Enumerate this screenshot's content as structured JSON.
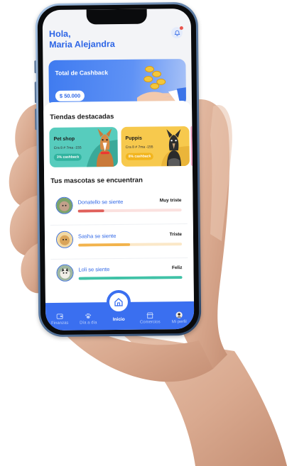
{
  "greeting": {
    "line1": "Hola,",
    "line2": "Maria Alejandra"
  },
  "icons": {
    "bell": "bell-icon",
    "hand_coins": "hand-coins-icon"
  },
  "cashback": {
    "title": "Total de Cashback",
    "amount": "$ 50.000"
  },
  "featured": {
    "title": "Tiendas destacadas",
    "stores": [
      {
        "name": "Pet shop",
        "address": "Cra 8 # 7ma -155",
        "badge": "3% cashback",
        "bg": "#57ccbd",
        "badge_color": "#31b39f"
      },
      {
        "name": "Puppis",
        "address": "Cra 8 # 7ma -155",
        "badge": "8% cashback",
        "bg": "#f7c94d",
        "badge_color": "#f2b51e"
      }
    ]
  },
  "pets": {
    "title": "Tus mascotas se encuentran",
    "items": [
      {
        "label": "Donatello se siente",
        "status": "Muy triste",
        "level": 0.25,
        "color": "#e0605b",
        "track": "#fbe1df"
      },
      {
        "label": "Sasha se siente",
        "status": "Triste",
        "level": 0.5,
        "color": "#f2b34c",
        "track": "#fbe8c8"
      },
      {
        "label": "Loli se siente",
        "status": "Feliz",
        "level": 1.0,
        "color": "#40c2a7",
        "track": "#d8f3ec"
      }
    ]
  },
  "tabbar": {
    "tabs": [
      {
        "label": "Finanzas",
        "icon": "wallet-icon"
      },
      {
        "label": "Día a día",
        "icon": "paw-icon"
      },
      {
        "label": "Inicio",
        "icon": "home-icon",
        "active": true
      },
      {
        "label": "Comercios",
        "icon": "store-icon"
      },
      {
        "label": "Mi perfil",
        "icon": "profile-avatar-icon"
      }
    ],
    "color": "#3a6ff0"
  }
}
